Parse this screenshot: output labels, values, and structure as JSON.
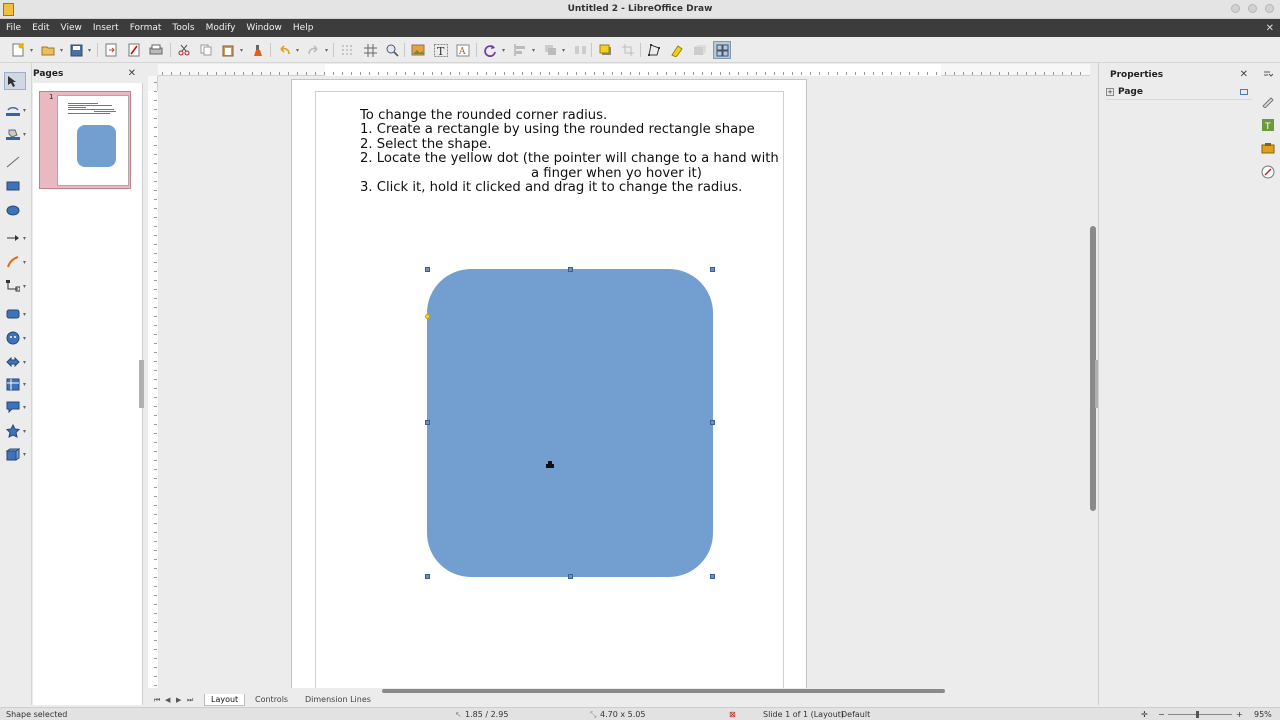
{
  "window": {
    "title": "Untitled 2 - LibreOffice Draw"
  },
  "menu": [
    "File",
    "Edit",
    "View",
    "Insert",
    "Format",
    "Tools",
    "Modify",
    "Window",
    "Help"
  ],
  "pages_panel": {
    "title": "Pages",
    "page_number": "1"
  },
  "document": {
    "lines": [
      "To change the rounded corner radius.",
      "1. Create a rectangle by using the rounded rectangle shape",
      "2. Select the shape.",
      "2. Locate the yellow dot (the pointer will change to a hand with",
      "a finger when yo hover it)",
      "3. Click it, hold it clicked and drag it to change the radius."
    ],
    "shape_fill": "#729fcf",
    "handle_color": "#ffd21f"
  },
  "tabs": [
    "Layout",
    "Controls",
    "Dimension Lines"
  ],
  "properties": {
    "title": "Properties",
    "section": "Page"
  },
  "status": {
    "message": "Shape selected",
    "position": "1.85 / 2.95",
    "size": "4.70 x 5.05",
    "slide": "Slide 1 of 1 (Layout)",
    "master": "Default",
    "zoom": "95%"
  }
}
